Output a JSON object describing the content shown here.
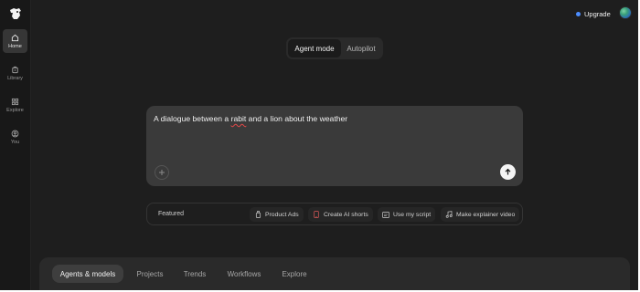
{
  "sidebar": {
    "logo_icon": "dog-head-logo",
    "items": [
      {
        "label": "Home",
        "icon": "home-icon",
        "active": true
      },
      {
        "label": "Library",
        "icon": "library-icon",
        "active": false
      },
      {
        "label": "Explore",
        "icon": "grid-icon",
        "active": false
      },
      {
        "label": "You",
        "icon": "user-icon",
        "active": false
      }
    ]
  },
  "header": {
    "upgrade_label": "Upgrade",
    "upgrade_dot_color": "#4c8dff"
  },
  "mode_switch": {
    "tabs": [
      {
        "label": "Agent mode",
        "active": true
      },
      {
        "label": "Autopilot",
        "active": false
      }
    ]
  },
  "prompt": {
    "text_before": "A dialogue between a ",
    "misspelled_word": "rabit",
    "text_after": " and a lion about the weather",
    "add_icon": "plus-icon",
    "send_icon": "arrow-up-icon"
  },
  "featured": {
    "label": "Featured",
    "chips": [
      {
        "label": "Product Ads",
        "icon": "bottle-icon"
      },
      {
        "label": "Create AI shorts",
        "icon": "phone-icon"
      },
      {
        "label": "Use my script",
        "icon": "script-icon"
      },
      {
        "label": "Make explainer video",
        "icon": "music-note-icon"
      }
    ]
  },
  "bottom_tabs": {
    "tabs": [
      {
        "label": "Agents & models",
        "active": true
      },
      {
        "label": "Projects",
        "active": false
      },
      {
        "label": "Trends",
        "active": false
      },
      {
        "label": "Workflows",
        "active": false
      },
      {
        "label": "Explore",
        "active": false
      }
    ]
  }
}
